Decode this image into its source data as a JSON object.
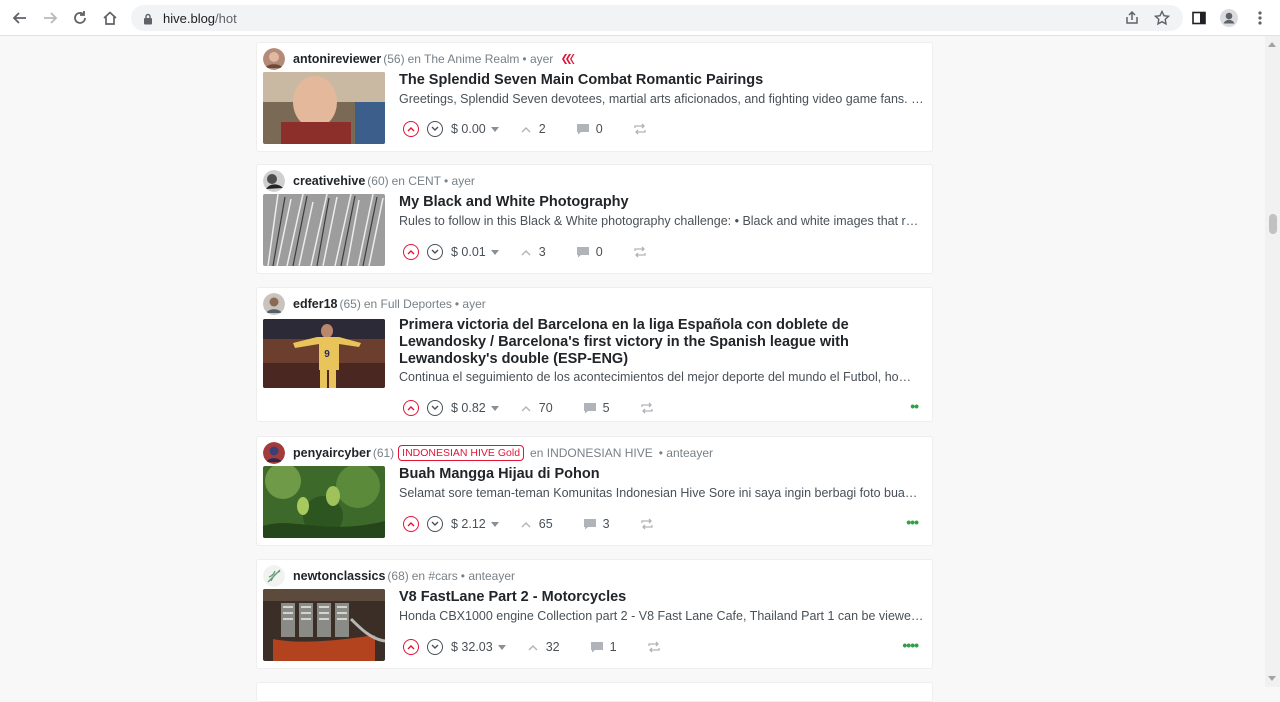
{
  "browser": {
    "url_host": "hive.blog",
    "url_path": "/hot"
  },
  "posts": [
    {
      "author": "antonireviewer",
      "rep": "(56)",
      "community": "en The Anime Realm",
      "time": "• ayer",
      "title": "The Splendid Seven Main Combat Romantic Pairings",
      "excerpt": "Greetings, Splendid Seven devotees, martial arts aficionados, and fighting video game fans. …",
      "payout": "$ 0.00",
      "votes": "2",
      "comments": "0"
    },
    {
      "author": "creativehive",
      "rep": "(60)",
      "community": "en CENT",
      "time": "• ayer",
      "title": "My Black and White Photography",
      "excerpt": "Rules to follow in this Black & White photography challenge: • Black and white images that r…",
      "payout": "$ 0.01",
      "votes": "3",
      "comments": "0"
    },
    {
      "author": "edfer18",
      "rep": "(65)",
      "community": "en Full Deportes",
      "time": "• ayer",
      "title": "Primera victoria del Barcelona en la liga Española con doblete de Lewandosky / Barcelona's first victory in the Spanish league with Lewandosky's double (ESP-ENG)",
      "excerpt": "Continua el seguimiento de los acontecimientos del mejor deporte del mundo el Futbol, ho…",
      "payout": "$ 0.82",
      "votes": "70",
      "comments": "5",
      "dots": "••"
    },
    {
      "author": "penyaircyber",
      "rep": "(61)",
      "badge": "INDONESIAN HIVE Gold",
      "community": "en INDONESIAN HIVE",
      "time": "• anteayer",
      "title": "Buah Mangga Hijau di Pohon",
      "excerpt": "Selamat sore teman-teman Komunitas Indonesian Hive Sore ini saya ingin berbagi foto bua…",
      "payout": "$ 2.12",
      "votes": "65",
      "comments": "3",
      "dots": "•••"
    },
    {
      "author": "newtonclassics",
      "rep": "(68)",
      "community": "en #cars",
      "time": "• anteayer",
      "title": "V8 FastLane Part 2 - Motorcycles",
      "excerpt": "Honda CBX1000 engine Collection part 2 - V8 Fast Lane Cafe, Thailand Part 1 can be viewed …",
      "payout": "$ 32.03",
      "votes": "32",
      "comments": "1",
      "dots": "••••"
    }
  ],
  "colors": {
    "accent": "#e31337",
    "dots": "#2ea04a"
  }
}
